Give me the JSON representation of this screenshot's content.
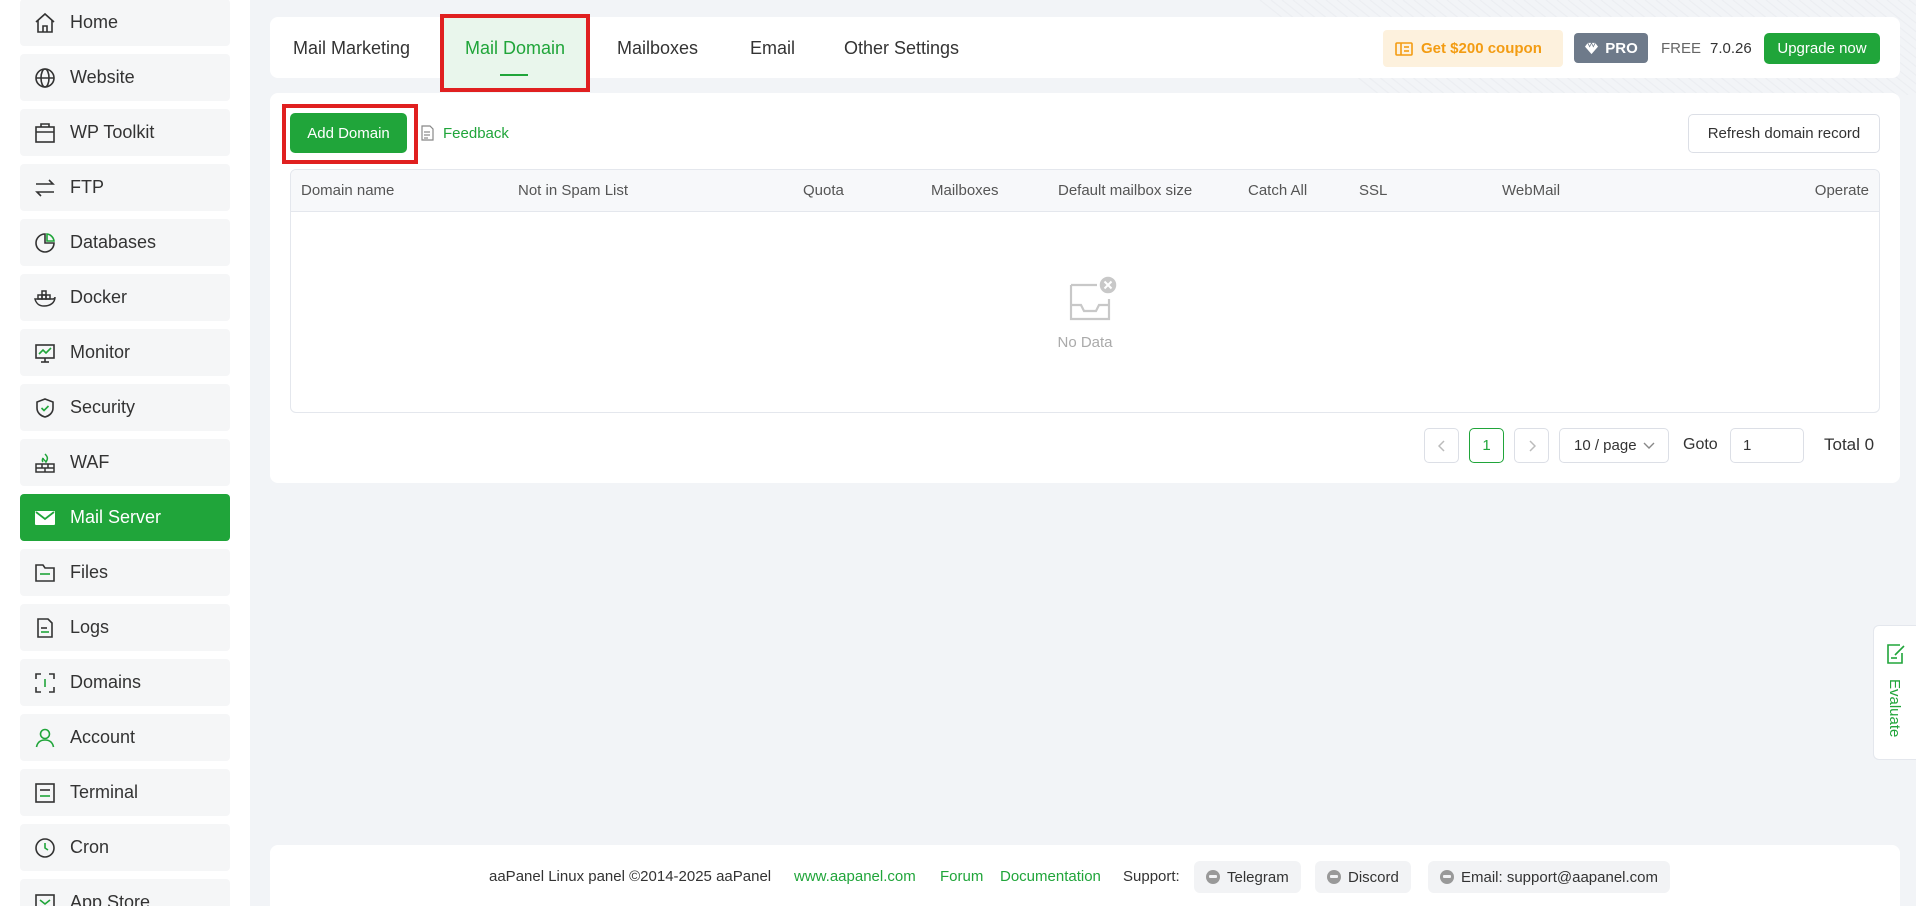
{
  "sidebar": {
    "items": [
      {
        "label": "Home",
        "icon": "home-icon"
      },
      {
        "label": "Website",
        "icon": "globe-icon"
      },
      {
        "label": "WP Toolkit",
        "icon": "toolkit-icon"
      },
      {
        "label": "FTP",
        "icon": "transfer-icon"
      },
      {
        "label": "Databases",
        "icon": "database-icon"
      },
      {
        "label": "Docker",
        "icon": "docker-icon"
      },
      {
        "label": "Monitor",
        "icon": "monitor-icon"
      },
      {
        "label": "Security",
        "icon": "shield-icon"
      },
      {
        "label": "WAF",
        "icon": "firewall-icon"
      },
      {
        "label": "Mail Server",
        "icon": "mail-icon",
        "active": true
      },
      {
        "label": "Files",
        "icon": "folder-icon"
      },
      {
        "label": "Logs",
        "icon": "log-icon"
      },
      {
        "label": "Domains",
        "icon": "domain-icon"
      },
      {
        "label": "Account",
        "icon": "user-icon"
      },
      {
        "label": "Terminal",
        "icon": "terminal-icon"
      },
      {
        "label": "Cron",
        "icon": "clock-icon"
      },
      {
        "label": "App Store",
        "icon": "app-store-icon"
      }
    ]
  },
  "tabs": [
    {
      "label": "Mail Marketing"
    },
    {
      "label": "Mail Domain",
      "active": true
    },
    {
      "label": "Mailboxes"
    },
    {
      "label": "Email"
    },
    {
      "label": "Other Settings"
    }
  ],
  "header": {
    "coupon": "Get $200 coupon",
    "pro": "PRO",
    "plan": "FREE",
    "version": "7.0.26",
    "upgrade": "Upgrade now"
  },
  "toolbar": {
    "add_domain": "Add Domain",
    "feedback": "Feedback",
    "refresh": "Refresh domain record"
  },
  "table": {
    "columns": [
      "Domain name",
      "Not in Spam List",
      "Quota",
      "Mailboxes",
      "Default mailbox size",
      "Catch All",
      "SSL",
      "WebMail",
      "Operate"
    ],
    "rows": [],
    "empty_text": "No Data"
  },
  "pagination": {
    "current_page": "1",
    "page_size": "10 / page",
    "goto_label": "Goto",
    "goto_value": "1",
    "total": "Total 0"
  },
  "evaluate": "Evaluate",
  "footer": {
    "copyright": "aaPanel Linux panel ©2014-2025 aaPanel",
    "website": "www.aapanel.com",
    "forum": "Forum",
    "documentation": "Documentation",
    "support_label": "Support:",
    "telegram": "Telegram",
    "discord": "Discord",
    "email": "Email: support@aapanel.com"
  },
  "colors": {
    "accent": "#20a53a",
    "highlight_border": "#e02020",
    "coupon_text": "#f39c12",
    "pro_badge": "#6e7a8a"
  }
}
